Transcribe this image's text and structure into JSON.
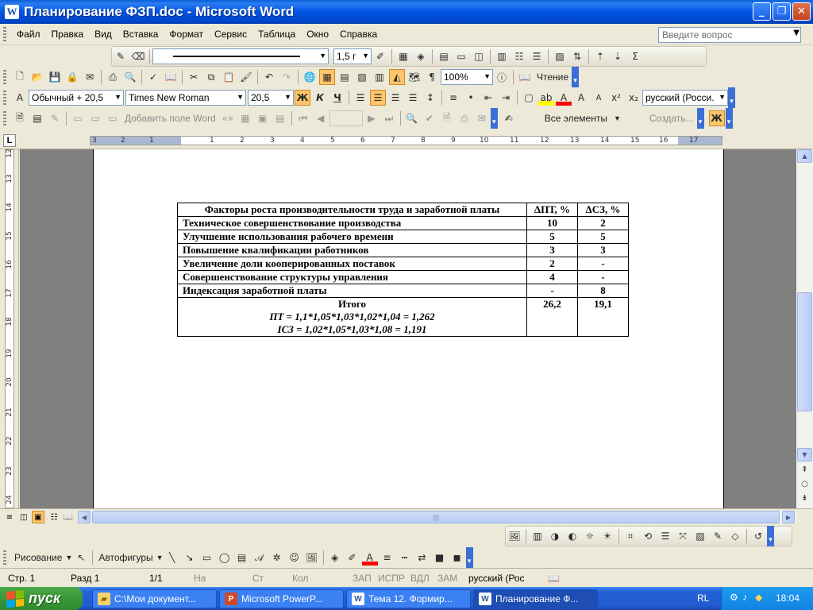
{
  "window": {
    "title": "Планирование ФЗП.doc - Microsoft Word"
  },
  "menu": {
    "items": [
      "Файл",
      "Правка",
      "Вид",
      "Вставка",
      "Формат",
      "Сервис",
      "Таблица",
      "Окно",
      "Справка"
    ],
    "ask_placeholder": "Введите вопрос"
  },
  "toolbar_tables": {
    "line_weight": "1,5 г"
  },
  "toolbar_standard": {
    "zoom": "100%",
    "reading_label": "Чтение"
  },
  "toolbar_format": {
    "style": "Обычный + 20,5",
    "font": "Times New Roman",
    "size": "20,5",
    "bold": "Ж",
    "italic": "К",
    "underline": "Ч",
    "language": "русский (Росси."
  },
  "toolbar_mailmerge": {
    "insert_field": "Добавить поле Word",
    "all_elements": "Все элементы",
    "create": "Создать...",
    "bold_short": "Ж"
  },
  "ruler": {
    "corner": "L",
    "h_numbers": [
      "3",
      "2",
      "1",
      "1",
      "2",
      "3",
      "4",
      "5",
      "6",
      "7",
      "8",
      "9",
      "10",
      "11",
      "12",
      "13",
      "14",
      "15",
      "16",
      "17"
    ],
    "v_numbers": [
      "12",
      "13",
      "14",
      "15",
      "16",
      "17",
      "18",
      "19",
      "20",
      "21",
      "22",
      "23",
      "24"
    ]
  },
  "table": {
    "headers": {
      "factors": "Факторы роста производительности труда и заработной платы",
      "dpt": "ΔПТ, %",
      "dsz": "ΔСЗ, %"
    },
    "rows": [
      {
        "factor": "Техническое совершенствование производства",
        "dpt": "10",
        "dsz": "2"
      },
      {
        "factor": "Улучшение использования рабочего времени",
        "dpt": "5",
        "dsz": "5"
      },
      {
        "factor": "Повышение квалификации работников",
        "dpt": "3",
        "dsz": "3"
      },
      {
        "factor": "Увеличение доли кооперированных поставок",
        "dpt": "2",
        "dsz": "-"
      },
      {
        "factor": "Совершенствование структуры управления",
        "dpt": "4",
        "dsz": "-"
      },
      {
        "factor": "Индексация заработной платы",
        "dpt": "-",
        "dsz": "8"
      }
    ],
    "total": {
      "label": "Итого",
      "formula_pt": "ПТ = 1,1*1,05*1,03*1,02*1,04 = 1,262",
      "formula_sz": "IСЗ = 1,02*1,05*1,03*1,08 = 1,191",
      "dpt": "26,2",
      "dsz": "19,1"
    }
  },
  "drawing_toolbar": {
    "drawing": "Рисование",
    "autoshapes": "Автофигуры"
  },
  "status": {
    "page": "Стр. 1",
    "section": "Разд 1",
    "pages": "1/1",
    "at": "На",
    "line": "Ст",
    "col": "Кол",
    "rec": "ЗАП",
    "trk": "ИСПР",
    "ext": "ВДЛ",
    "ovr": "ЗАМ",
    "language": "русский (Рос"
  },
  "taskbar": {
    "start": "пуск",
    "tasks": [
      {
        "label": "C:\\Мои документ...",
        "icon": "folder-icon"
      },
      {
        "label": "Microsoft PowerP...",
        "icon": "powerpoint-icon"
      },
      {
        "label": "Тема 12. Формир...",
        "icon": "word-icon"
      },
      {
        "label": "Планирование Ф...",
        "icon": "word-icon"
      }
    ],
    "lang": "RL",
    "clock": "18:04"
  }
}
